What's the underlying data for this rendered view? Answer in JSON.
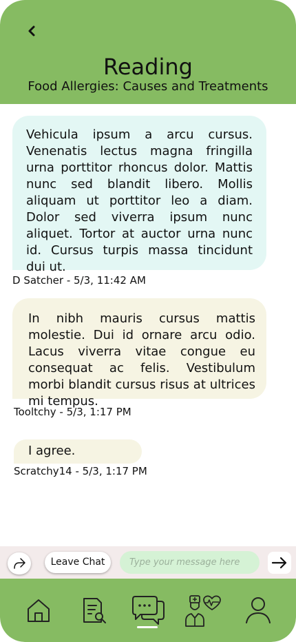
{
  "header": {
    "title": "Reading",
    "subtitle": "Food Allergies: Causes and Treatments",
    "back_icon": "chevron-left-icon"
  },
  "messages": [
    {
      "text": "Vehicula ipsum a arcu cursus. Venenatis lectus magna fringilla urna porttitor rhoncus dolor. Mattis nunc sed blandit libero. Mollis aliquam ut porttitor leo a diam. Dolor sed viverra ipsum nunc aliquet. Tortor at auctor urna nunc id. Cursus turpis massa tincidunt dui ut.",
      "meta": "D Satcher - 5/3, 11:42 AM",
      "color": "#e3f7f4"
    },
    {
      "text": "In nibh mauris cursus mattis molestie. Dui id ornare arcu odio. Lacus viverra vitae congue eu consequat ac felis. Vestibulum morbi blandit cursus risus at ultrices mi tempus.",
      "meta": "Tooltchy - 5/3, 1:17 PM",
      "color": "#f6f4e3"
    },
    {
      "text": "I agree.",
      "meta": "Scratchy14 - 5/3, 1:17 PM",
      "color": "#f6f4e3"
    }
  ],
  "composer": {
    "share_icon": "share-icon",
    "leave_label": "Leave Chat",
    "placeholder": "Type your message here",
    "value": "",
    "send_icon": "arrow-right-icon"
  },
  "navbar": {
    "items": [
      {
        "name": "Home",
        "icon": "home-icon"
      },
      {
        "name": "Search Documents",
        "icon": "document-search-icon"
      },
      {
        "name": "Chat",
        "icon": "chat-bubbles-icon",
        "active": true
      },
      {
        "name": "Doctor Health",
        "icon": "doctor-heart-icon"
      },
      {
        "name": "Profile",
        "icon": "user-icon"
      }
    ]
  },
  "colors": {
    "header_green": "#86bb62",
    "composer_bg": "#f3ebeb",
    "input_green": "#d5f2d5"
  }
}
